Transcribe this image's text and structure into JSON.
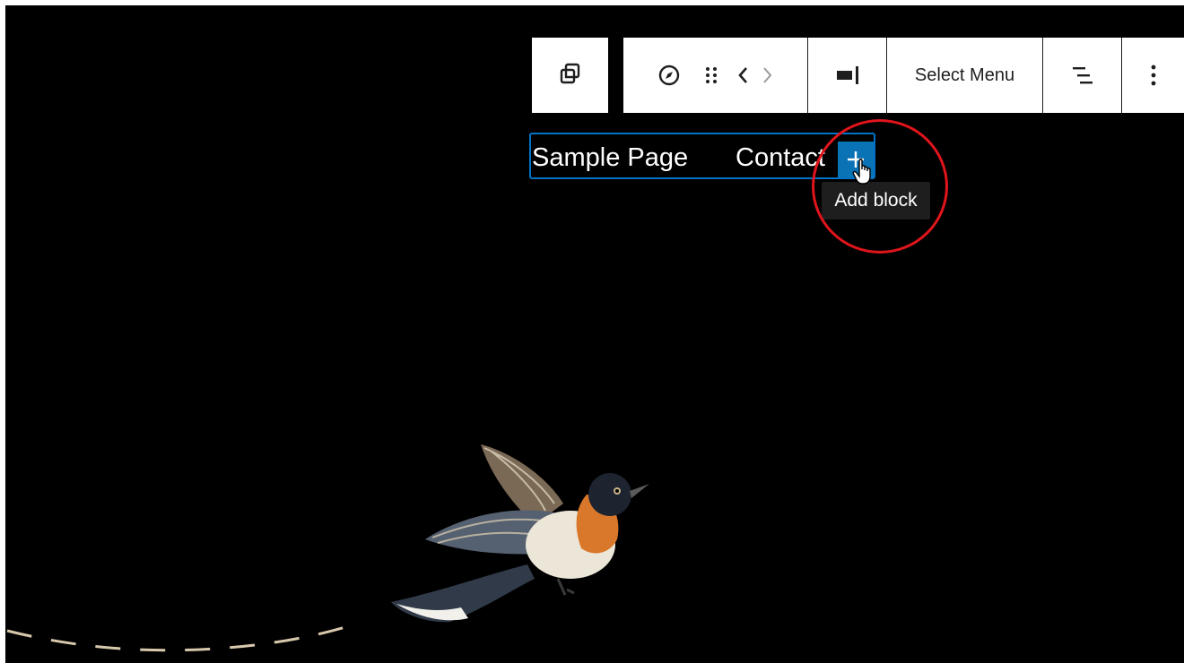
{
  "toolbar": {
    "parent_icon": "copy-stack-icon",
    "navigation_icon": "compass-icon",
    "drag_icon": "drag-handle-icon",
    "move_left_icon": "chevron-left-icon",
    "move_right_icon": "chevron-right-icon",
    "justify_icon": "justify-right-icon",
    "select_menu_label": "Select Menu",
    "list_view_icon": "list-view-icon",
    "more_icon": "more-vertical-icon"
  },
  "navigation": {
    "items": [
      {
        "label": "Sample Page"
      },
      {
        "label": "Contact"
      }
    ],
    "add_icon": "plus-icon",
    "tooltip": "Add block"
  },
  "colors": {
    "canvas_bg": "#000000",
    "accent": "#0a73b5",
    "highlight": "#e0151b",
    "toolbar_bg": "#ffffff",
    "tooltip_bg": "#1e1e1e"
  }
}
